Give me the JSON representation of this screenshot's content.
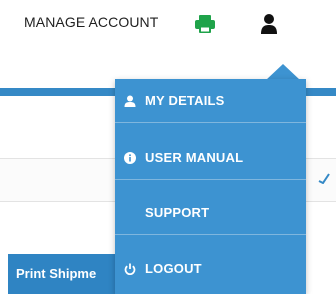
{
  "header": {
    "title": "MANAGE ACCOUNT",
    "icons": [
      "printer-icon",
      "user-icon"
    ]
  },
  "page": {
    "button_partial": "Print Shipme"
  },
  "dropdown": {
    "items": [
      {
        "label": "MY DETAILS",
        "icon": "user-icon"
      },
      {
        "label": "USER MANUAL",
        "icon": "info-icon"
      },
      {
        "label": "SUPPORT",
        "icon": ""
      },
      {
        "label": "LOGOUT",
        "icon": "power-icon"
      }
    ]
  },
  "colors": {
    "accent_blue": "#3589c6",
    "menu_blue": "#3d93d1",
    "printer_green": "#1fa34a"
  }
}
